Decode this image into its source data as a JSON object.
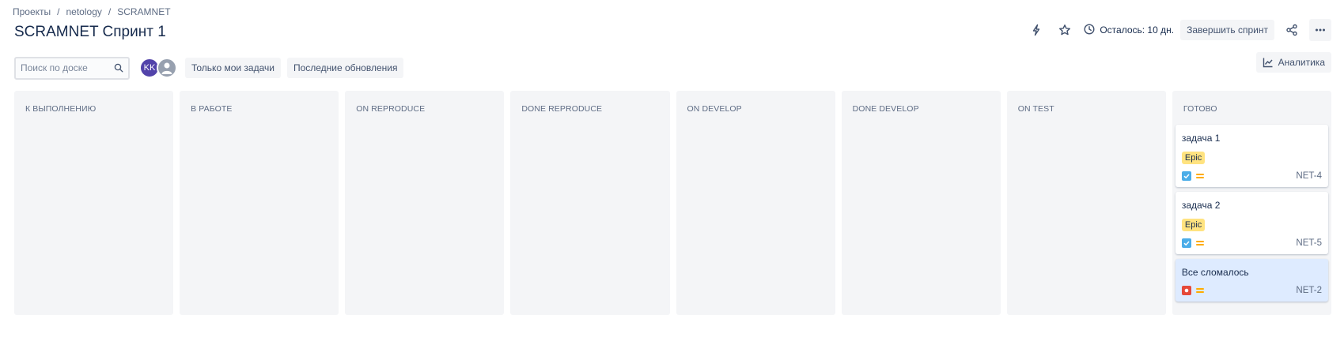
{
  "breadcrumb": [
    "Проекты",
    "netology",
    "SCRAMNET"
  ],
  "page_title": "SCRAMNET Спринт 1",
  "actions": {
    "remaining": "Осталось: 10 дн.",
    "complete_sprint": "Завершить спринт"
  },
  "toolbar": {
    "search_placeholder": "Поиск по доске",
    "avatar_initials": "KK",
    "only_my_tasks": "Только мои задачи",
    "recent_updates": "Последние обновления",
    "analytics": "Аналитика"
  },
  "colors": {
    "avatar": "#5243aa",
    "epic": "#ffe380",
    "task_icon": "#4bade8",
    "bug_icon": "#e5493a",
    "priority": "#ffab00",
    "highlight_card": "#deebff"
  },
  "columns": [
    {
      "title": "К ВЫПОЛНЕНИЮ",
      "cards": []
    },
    {
      "title": "В РАБОТЕ",
      "cards": []
    },
    {
      "title": "ON REPRODUCE",
      "cards": []
    },
    {
      "title": "DONE REPRODUCE",
      "cards": []
    },
    {
      "title": "ON DEVELOP",
      "cards": []
    },
    {
      "title": "DONE DEVELOP",
      "cards": []
    },
    {
      "title": "ON TEST",
      "cards": []
    },
    {
      "title": "ГОТОВО",
      "cards": [
        {
          "title": "задача 1",
          "epic": "Epic",
          "type": "task",
          "priority": "medium",
          "key": "NET-4",
          "highlight": false
        },
        {
          "title": "задача 2",
          "epic": "Epic",
          "type": "task",
          "priority": "medium",
          "key": "NET-5",
          "highlight": false
        },
        {
          "title": "Все сломалось",
          "epic": null,
          "type": "bug",
          "priority": "medium",
          "key": "NET-2",
          "highlight": true
        }
      ]
    }
  ]
}
